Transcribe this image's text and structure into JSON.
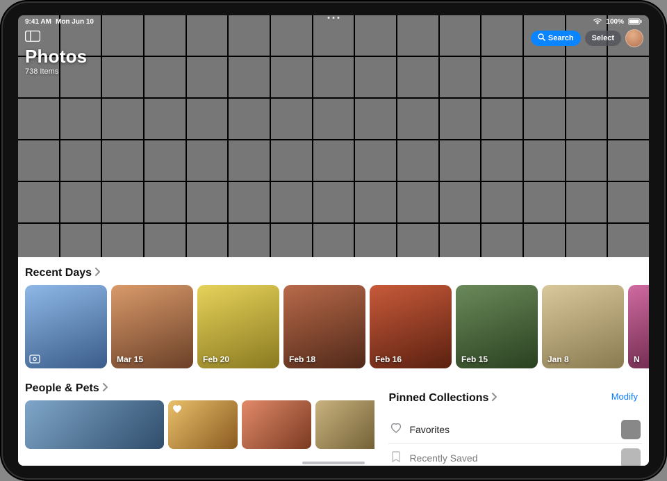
{
  "status": {
    "time": "9:41 AM",
    "date": "Mon Jun 10",
    "battery": "100%"
  },
  "header": {
    "title": "Photos",
    "count": "738 Items"
  },
  "controls": {
    "search_label": "Search",
    "select_label": "Select"
  },
  "recent_days": {
    "title": "Recent Days",
    "cards": [
      {
        "label": "",
        "has_badge": true
      },
      {
        "label": "Mar 15"
      },
      {
        "label": "Feb 20"
      },
      {
        "label": "Feb 18"
      },
      {
        "label": "Feb 16"
      },
      {
        "label": "Feb 15"
      },
      {
        "label": "Jan 8"
      },
      {
        "label": "N"
      }
    ]
  },
  "people_pets": {
    "title": "People & Pets"
  },
  "pinned": {
    "title": "Pinned Collections",
    "modify_label": "Modify",
    "rows": [
      {
        "icon": "heart",
        "label": "Favorites"
      },
      {
        "icon": "bookmark",
        "label": "Recently Saved"
      }
    ]
  }
}
